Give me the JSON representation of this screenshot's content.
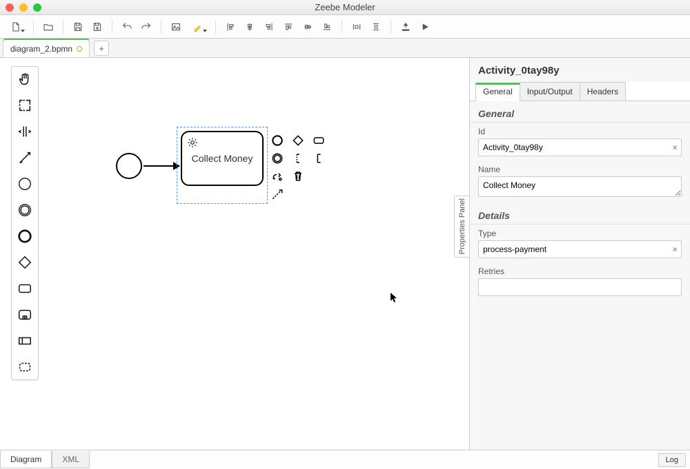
{
  "window": {
    "title": "Zeebe Modeler"
  },
  "file_tab": {
    "name": "diagram_2.bpmn",
    "dirty": true
  },
  "bottom_tabs": {
    "diagram": "Diagram",
    "xml": "XML",
    "log": "Log"
  },
  "canvas": {
    "task_label": "Collect Money"
  },
  "props": {
    "header": "Activity_0tay98y",
    "tabs": {
      "general": "General",
      "io": "Input/Output",
      "headers": "Headers"
    },
    "group_general": "General",
    "id_label": "Id",
    "id_value": "Activity_0tay98y",
    "name_label": "Name",
    "name_value": "Collect Money",
    "group_details": "Details",
    "type_label": "Type",
    "type_value": "process-payment",
    "retries_label": "Retries",
    "retries_value": ""
  },
  "panel_tab": "Properties Panel"
}
